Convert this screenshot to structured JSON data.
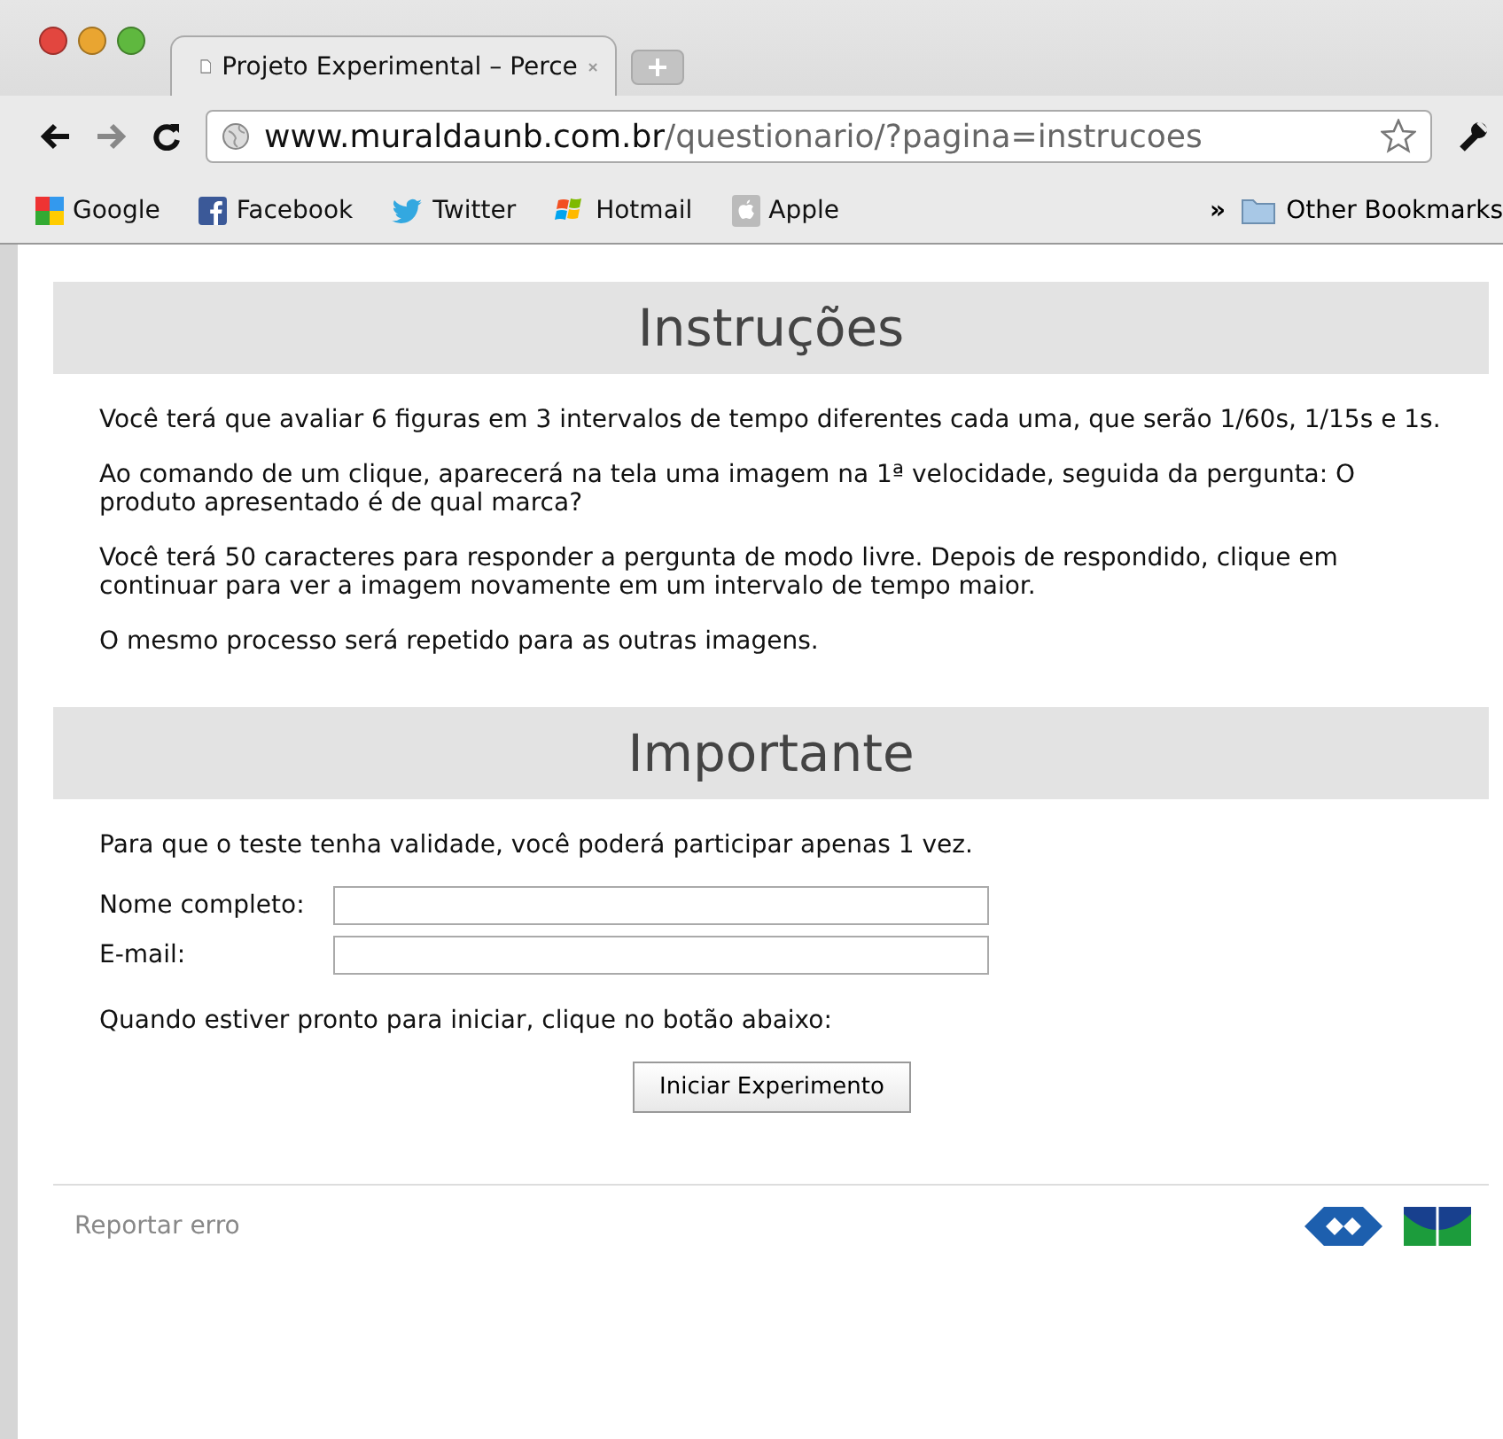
{
  "browser": {
    "tab": {
      "title": "Projeto Experimental – Perce",
      "selected": true
    },
    "url": {
      "domain": "www.muraldaunb.com.br",
      "path": "/questionario/?pagina=instrucoes"
    },
    "bookmarks": [
      {
        "label": "Google",
        "kind": "google"
      },
      {
        "label": "Facebook",
        "kind": "facebook"
      },
      {
        "label": "Twitter",
        "kind": "twitter"
      },
      {
        "label": "Hotmail",
        "kind": "windows"
      },
      {
        "label": "Apple",
        "kind": "apple"
      }
    ],
    "overflow": "»",
    "other_bookmarks": "Other Bookmarks"
  },
  "sections": [
    {
      "heading": "Instruções",
      "paragraphs": [
        "Você terá que avaliar 6 figuras em 3 intervalos de tempo diferentes cada uma, que serão 1/60s, 1/15s e 1s.",
        "Ao comando de um clique, aparecerá na tela uma imagem na 1ª velocidade, seguida da pergunta: O produto apresentado é de qual marca?",
        "Você terá 50 caracteres para responder a pergunta de modo livre. Depois de respondido, clique em continuar para ver a imagem novamente em um intervalo de tempo maior.",
        "O mesmo processo será repetido para as outras imagens."
      ]
    },
    {
      "heading": "Importante",
      "paragraphs": [
        "Para que o teste tenha validade, você poderá participar apenas 1 vez."
      ]
    }
  ],
  "form": {
    "fields": [
      {
        "label": "Nome completo:"
      },
      {
        "label": "E-mail:"
      }
    ],
    "prompt": "Quando estiver pronto para iniciar, clique no botão abaixo:",
    "button": "Iniciar Experimento"
  },
  "footer": {
    "link": "Reportar erro"
  }
}
